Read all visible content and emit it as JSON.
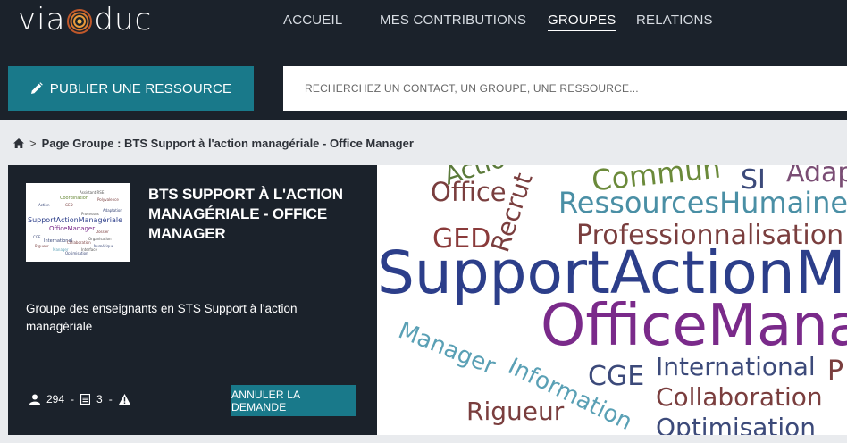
{
  "header": {
    "logo_text_left": "via",
    "logo_text_right": "duc",
    "nav": [
      {
        "label": "ACCUEIL",
        "active": false
      },
      {
        "label": "MES CONTRIBUTIONS",
        "active": false
      },
      {
        "label": "GROUPES",
        "active": true
      },
      {
        "label": "RELATIONS",
        "active": false
      }
    ]
  },
  "toolbar": {
    "publish_label": "PUBLIER UNE RESSOURCE",
    "search_placeholder": "RECHERCHEZ UN CONTACT, UN GROUPE, UNE RESSOURCE..."
  },
  "breadcrumb": {
    "icon": "home-icon",
    "separator": ">",
    "text": "Page Groupe : BTS Support à l'action managériale - Office Manager"
  },
  "group": {
    "title": "BTS SUPPORT À L'ACTION MANAGÉRIALE - OFFICE MANAGER",
    "description": "Groupe des enseignants en STS Support à l'action managériale",
    "members_count": "294",
    "resources_count": "3",
    "stat_sep": "-",
    "cancel_label": "ANNULER LA DEMANDE"
  },
  "thumb_words": [
    "Assistant RSE",
    "Coordination",
    "Polyvalence",
    "Action",
    "GED",
    "Adaptation",
    "Processus",
    "SupportActionManagériale",
    "OfficeManager",
    "Dossier",
    "CGE",
    "International",
    "Collaboration",
    "Rigueur",
    "Organisation",
    "Manager",
    "Optimisation",
    "Numérique",
    "Interface"
  ],
  "cloud_words": [
    {
      "text": "Action",
      "color": "#5b7a3a"
    },
    {
      "text": "Commun",
      "color": "#6b8a3a"
    },
    {
      "text": "Adap",
      "color": "#7a4d74"
    },
    {
      "text": "Office",
      "color": "#7a3e3e"
    },
    {
      "text": "Recrut",
      "color": "#7a3e3e"
    },
    {
      "text": "SI",
      "color": "#3c4a7a"
    },
    {
      "text": "RessourcesHumaines",
      "color": "#4a8fa5"
    },
    {
      "text": "GED",
      "color": "#8a3a3a"
    },
    {
      "text": "Professionnalisation",
      "color": "#7a3e3e"
    },
    {
      "text": "SupportActionMa",
      "color": "#2c3e8a"
    },
    {
      "text": "OfficeMana",
      "color": "#7a2a8a"
    },
    {
      "text": "Manager",
      "color": "#5aa0b5"
    },
    {
      "text": "Information",
      "color": "#5aa0b5"
    },
    {
      "text": "CGE",
      "color": "#3c4a7a"
    },
    {
      "text": "International",
      "color": "#3c4a7a"
    },
    {
      "text": "Collaboration",
      "color": "#7a3e3e"
    },
    {
      "text": "Rigueur",
      "color": "#7a3e3e"
    },
    {
      "text": "Optimisation",
      "color": "#3c4a7a"
    },
    {
      "text": "P",
      "color": "#7a3e3e"
    }
  ]
}
